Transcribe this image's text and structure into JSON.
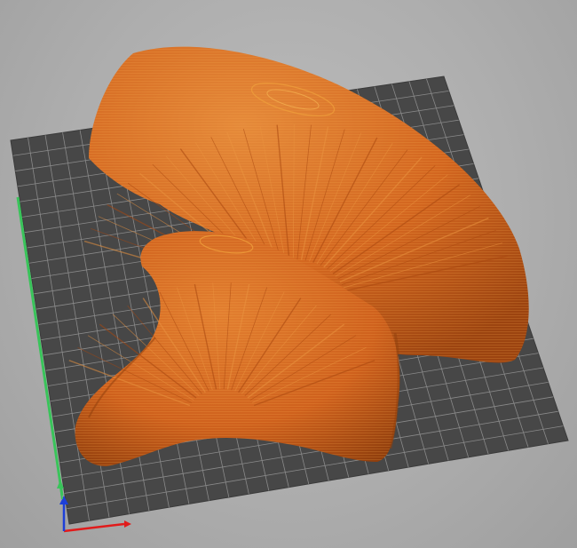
{
  "app": {
    "view": "3d-slice-preview"
  },
  "scene": {
    "background_color": "#b0b0b0",
    "bed_color": "#474747",
    "bed_grid_color": "#8a8a8a",
    "model_color": "#d3661f",
    "model_highlight_color": "#f0a13c",
    "model_shadow_color": "#8e3d0c",
    "axis_colors": {
      "x": "#e11b1b",
      "y": "#39c45a",
      "z": "#1d3fd8"
    }
  },
  "icons": {
    "axes": "xyz-axes-icon"
  }
}
